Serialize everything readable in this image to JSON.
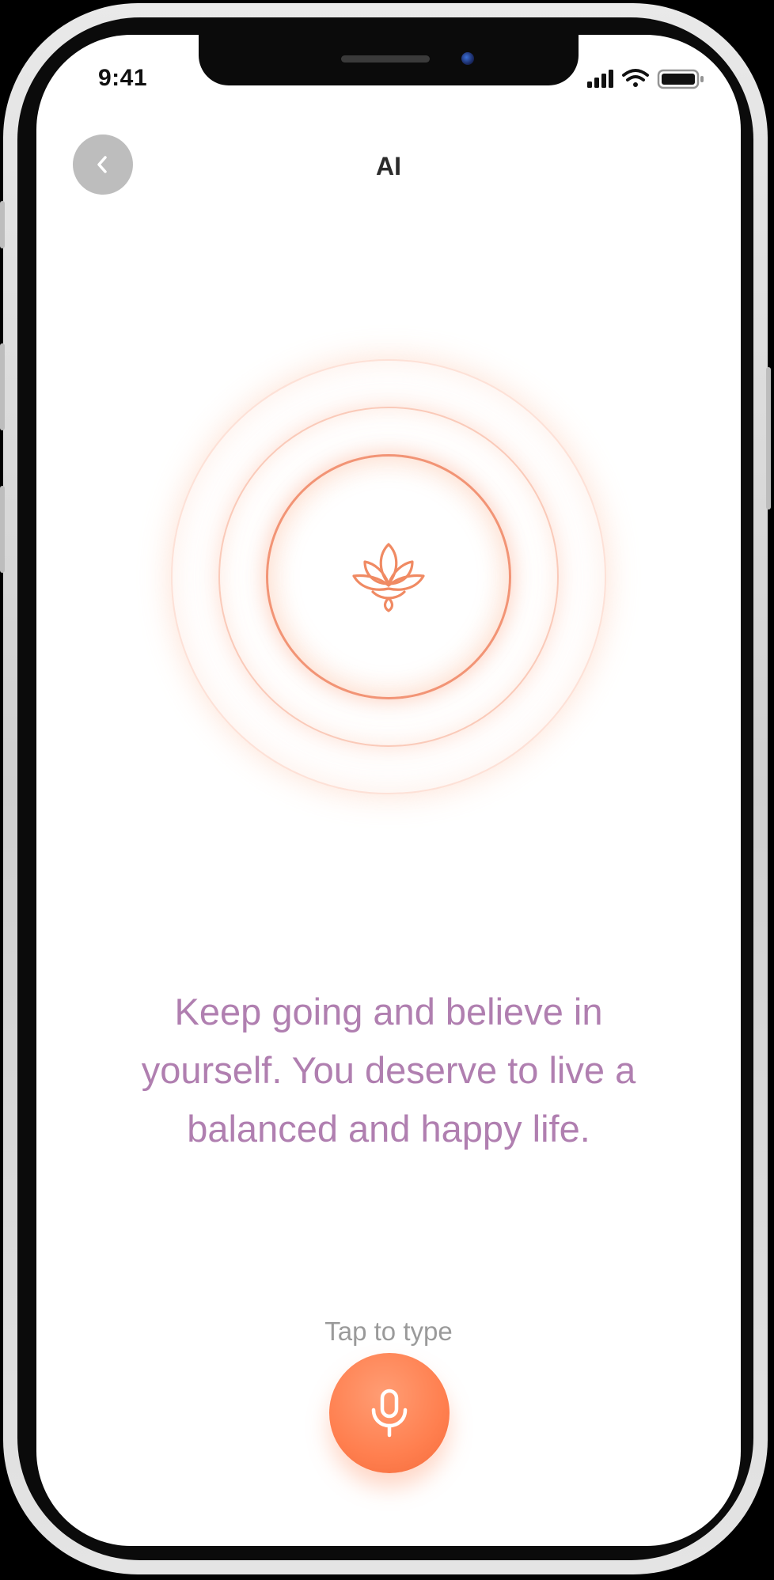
{
  "status_bar": {
    "time": "9:41"
  },
  "header": {
    "title": "AI",
    "back_icon": "chevron-left-icon"
  },
  "orb": {
    "icon": "lotus-icon",
    "accent_color": "#f08a63"
  },
  "main": {
    "message": "Keep going and believe in yourself. You deserve to live a balanced and happy life."
  },
  "input": {
    "tap_to_type_label": "Tap to type",
    "mic_icon": "microphone-icon",
    "mic_color": "#ff8a5c"
  },
  "colors": {
    "message_text": "#b07fb0",
    "hint_text": "#9a9a9a",
    "back_button_bg": "#bdbdbd"
  }
}
